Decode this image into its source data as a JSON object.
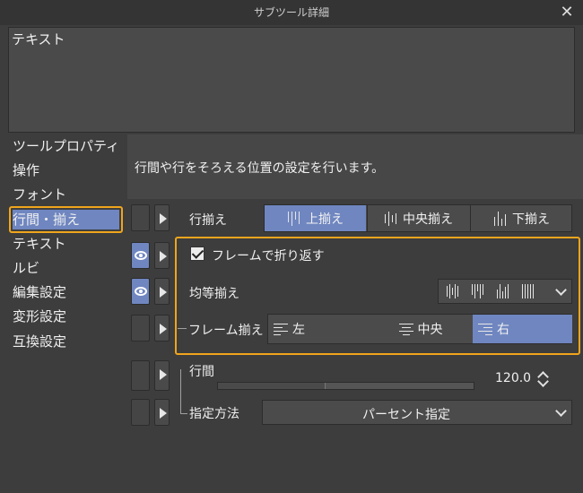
{
  "window": {
    "title": "サブツール詳細"
  },
  "preview": {
    "text": "テキスト"
  },
  "sidebar": {
    "items": [
      {
        "label": "ツールプロパティ"
      },
      {
        "label": "操作"
      },
      {
        "label": "フォント"
      },
      {
        "label": "行間・揃え",
        "selected": true
      },
      {
        "label": "テキスト"
      },
      {
        "label": "ルビ"
      },
      {
        "label": "編集設定"
      },
      {
        "label": "変形設定"
      },
      {
        "label": "互換設定"
      }
    ]
  },
  "description": "行間や行をそろえる位置の設定を行います。",
  "line_align": {
    "label": "行揃え",
    "options": [
      {
        "label": "上揃え",
        "icon": "align-top-icon",
        "selected": true
      },
      {
        "label": "中央揃え",
        "icon": "align-middle-icon",
        "selected": false
      },
      {
        "label": "下揃え",
        "icon": "align-bottom-icon",
        "selected": false
      }
    ]
  },
  "wrap_frame": {
    "label": "フレームで折り返す",
    "checked": true
  },
  "distribute": {
    "label": "均等揃え"
  },
  "frame_align": {
    "label": "フレーム揃え",
    "options": [
      {
        "label": "左",
        "icon": "align-left-icon",
        "selected": false
      },
      {
        "label": "中央",
        "icon": "align-center-icon",
        "selected": false
      },
      {
        "label": "右",
        "icon": "align-right-icon",
        "selected": true
      }
    ]
  },
  "line_spacing": {
    "label": "行間",
    "value": "120.0",
    "fill_fraction": 0.42
  },
  "spacing_method": {
    "label": "指定方法",
    "value": "パーセント指定"
  },
  "colors": {
    "accent": "#6f86c0",
    "highlight": "#f0a51c",
    "background": "#3d3d3d"
  }
}
